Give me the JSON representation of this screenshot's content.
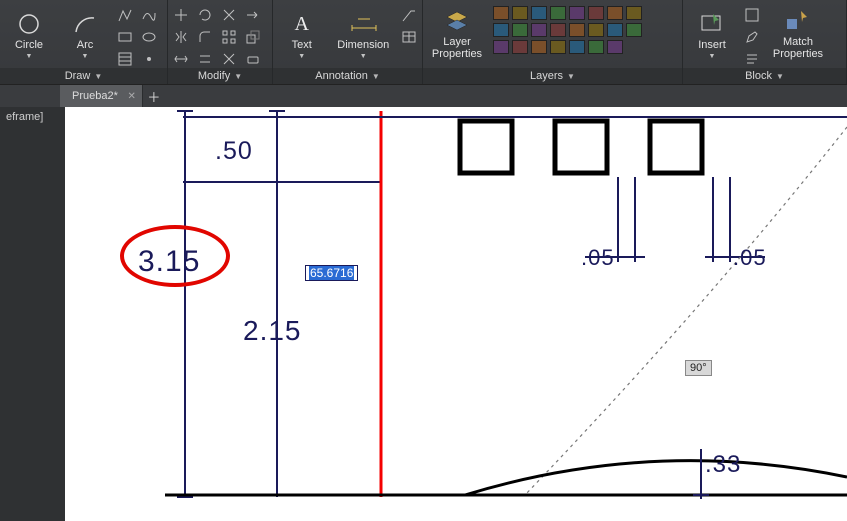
{
  "ribbon": {
    "draw": {
      "title": "Draw",
      "circle": "Circle",
      "arc": "Arc"
    },
    "modify": {
      "title": "Modify"
    },
    "annotation": {
      "title": "Annotation",
      "text": "Text",
      "dimension": "Dimension"
    },
    "layers": {
      "title": "Layers",
      "layer_properties": "Layer\nProperties"
    },
    "block": {
      "title": "Block",
      "insert": "Insert",
      "match_properties": "Match\nProperties"
    }
  },
  "tabs": {
    "active": "Prueba2*"
  },
  "sidebar": {
    "view_mode": "eframe]"
  },
  "drawing": {
    "dims": {
      "d_050": ".50",
      "d_315": "3.15",
      "d_215": "2.15",
      "d_005a": ".05",
      "d_005b": ".05",
      "d_033": ".33"
    },
    "dynamic_distance": "65.6716",
    "angle_badge": "90°"
  },
  "colors": {
    "dim": "#1a1a5a",
    "annot": "#e10600",
    "active_line": "#f40000"
  }
}
